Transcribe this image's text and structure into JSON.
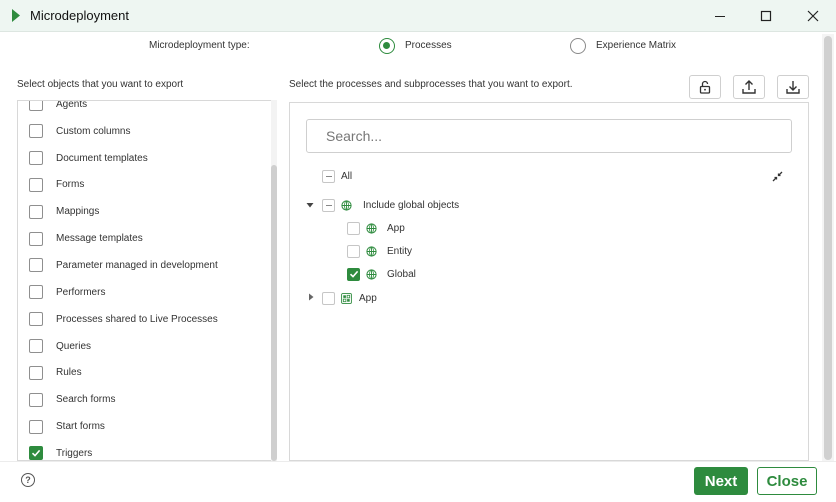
{
  "window": {
    "title": "Microdeployment",
    "accent": "#2e8b3e"
  },
  "type_row": {
    "label": "Microdeployment type:",
    "options": [
      {
        "label": "Processes",
        "selected": true
      },
      {
        "label": "Experience Matrix",
        "selected": false
      }
    ]
  },
  "left": {
    "hint": "Select objects that you want to export",
    "items": [
      {
        "label": "Agents",
        "checked": false
      },
      {
        "label": "Custom columns",
        "checked": false
      },
      {
        "label": "Document templates",
        "checked": false
      },
      {
        "label": "Forms",
        "checked": false
      },
      {
        "label": "Mappings",
        "checked": false
      },
      {
        "label": "Message templates",
        "checked": false
      },
      {
        "label": "Parameter managed in development",
        "checked": false
      },
      {
        "label": "Performers",
        "checked": false
      },
      {
        "label": "Processes shared to Live Processes",
        "checked": false
      },
      {
        "label": "Queries",
        "checked": false
      },
      {
        "label": "Rules",
        "checked": false
      },
      {
        "label": "Search forms",
        "checked": false
      },
      {
        "label": "Start forms",
        "checked": false
      },
      {
        "label": "Triggers",
        "checked": true
      }
    ]
  },
  "right": {
    "hint": "Select the processes and subprocesses that you want to export.",
    "toolbar": [
      "unlock-icon",
      "upload-icon",
      "download-icon"
    ],
    "search_placeholder": "Search...",
    "tree": {
      "all_label": "All",
      "include_global": "Include global objects",
      "global_children": [
        {
          "label": "App",
          "checked": false
        },
        {
          "label": "Entity",
          "checked": false
        },
        {
          "label": "Global",
          "checked": true
        }
      ],
      "app_label": "App"
    }
  },
  "footer": {
    "next_label": "Next",
    "close_label": "Close",
    "help_symbol": "?"
  }
}
